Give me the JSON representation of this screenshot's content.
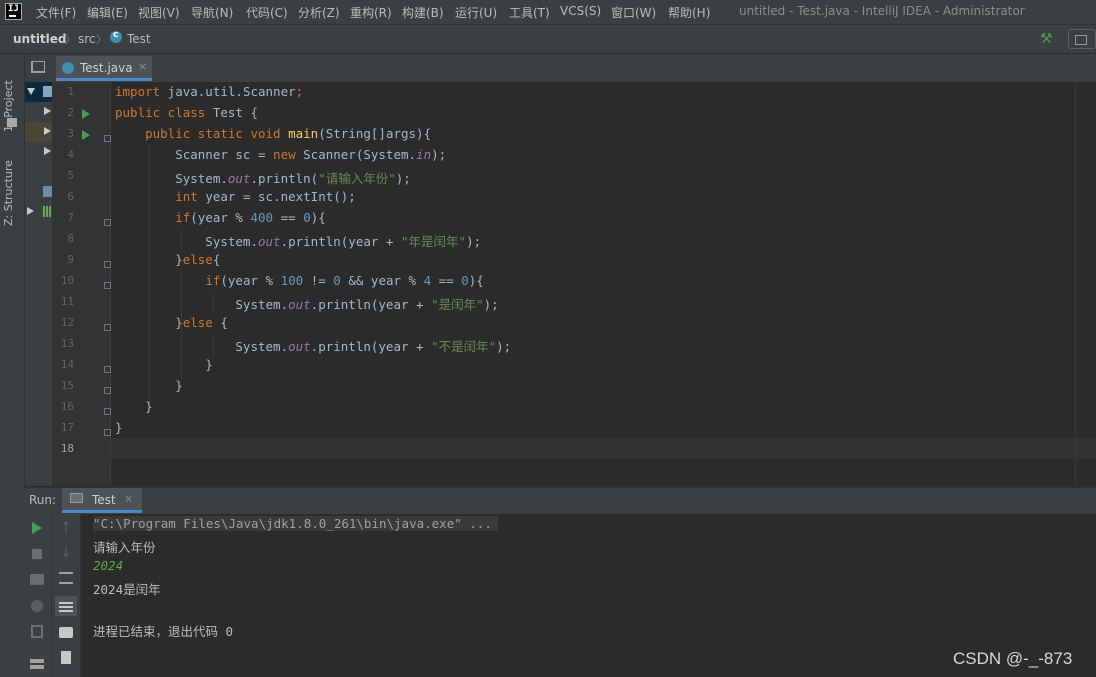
{
  "menubar": {
    "items": [
      "文件(F)",
      "编辑(E)",
      "视图(V)",
      "导航(N)",
      "代码(C)",
      "分析(Z)",
      "重构(R)",
      "构建(B)",
      "运行(U)",
      "工具(T)",
      "VCS(S)",
      "窗口(W)",
      "帮助(H)"
    ],
    "window_title": "untitled - Test.java - IntelliJ IDEA - Administrator"
  },
  "navbar": {
    "project": "untitled",
    "folder": "src",
    "file": "Test"
  },
  "left_strip": {
    "project_tab": "1: Project",
    "structure_tab": "Z: Structure"
  },
  "editor": {
    "tab_label": "Test.java",
    "tab_close": "×",
    "line_numbers": [
      "1",
      "2",
      "3",
      "4",
      "5",
      "6",
      "7",
      "8",
      "9",
      "10",
      "11",
      "12",
      "13",
      "14",
      "15",
      "16",
      "17",
      "18"
    ],
    "current_line": "18"
  },
  "run_panel": {
    "label": "Run:",
    "tab_label": "Test",
    "tab_close": "×",
    "output": {
      "cmd": "\"C:\\Program Files\\Java\\jdk1.8.0_261\\bin\\java.exe\" ...",
      "prompt": "请输入年份",
      "user_input": "2024",
      "result": "2024是闰年",
      "exit": "进程已结束，退出代码 0"
    }
  },
  "watermark": "CSDN @-_-873",
  "colors": {
    "keyword": "#cc7832",
    "number": "#6897bb",
    "string": "#6a8759",
    "field": "#9876aa",
    "method": "#ffc66d",
    "run_green": "#499c54"
  }
}
